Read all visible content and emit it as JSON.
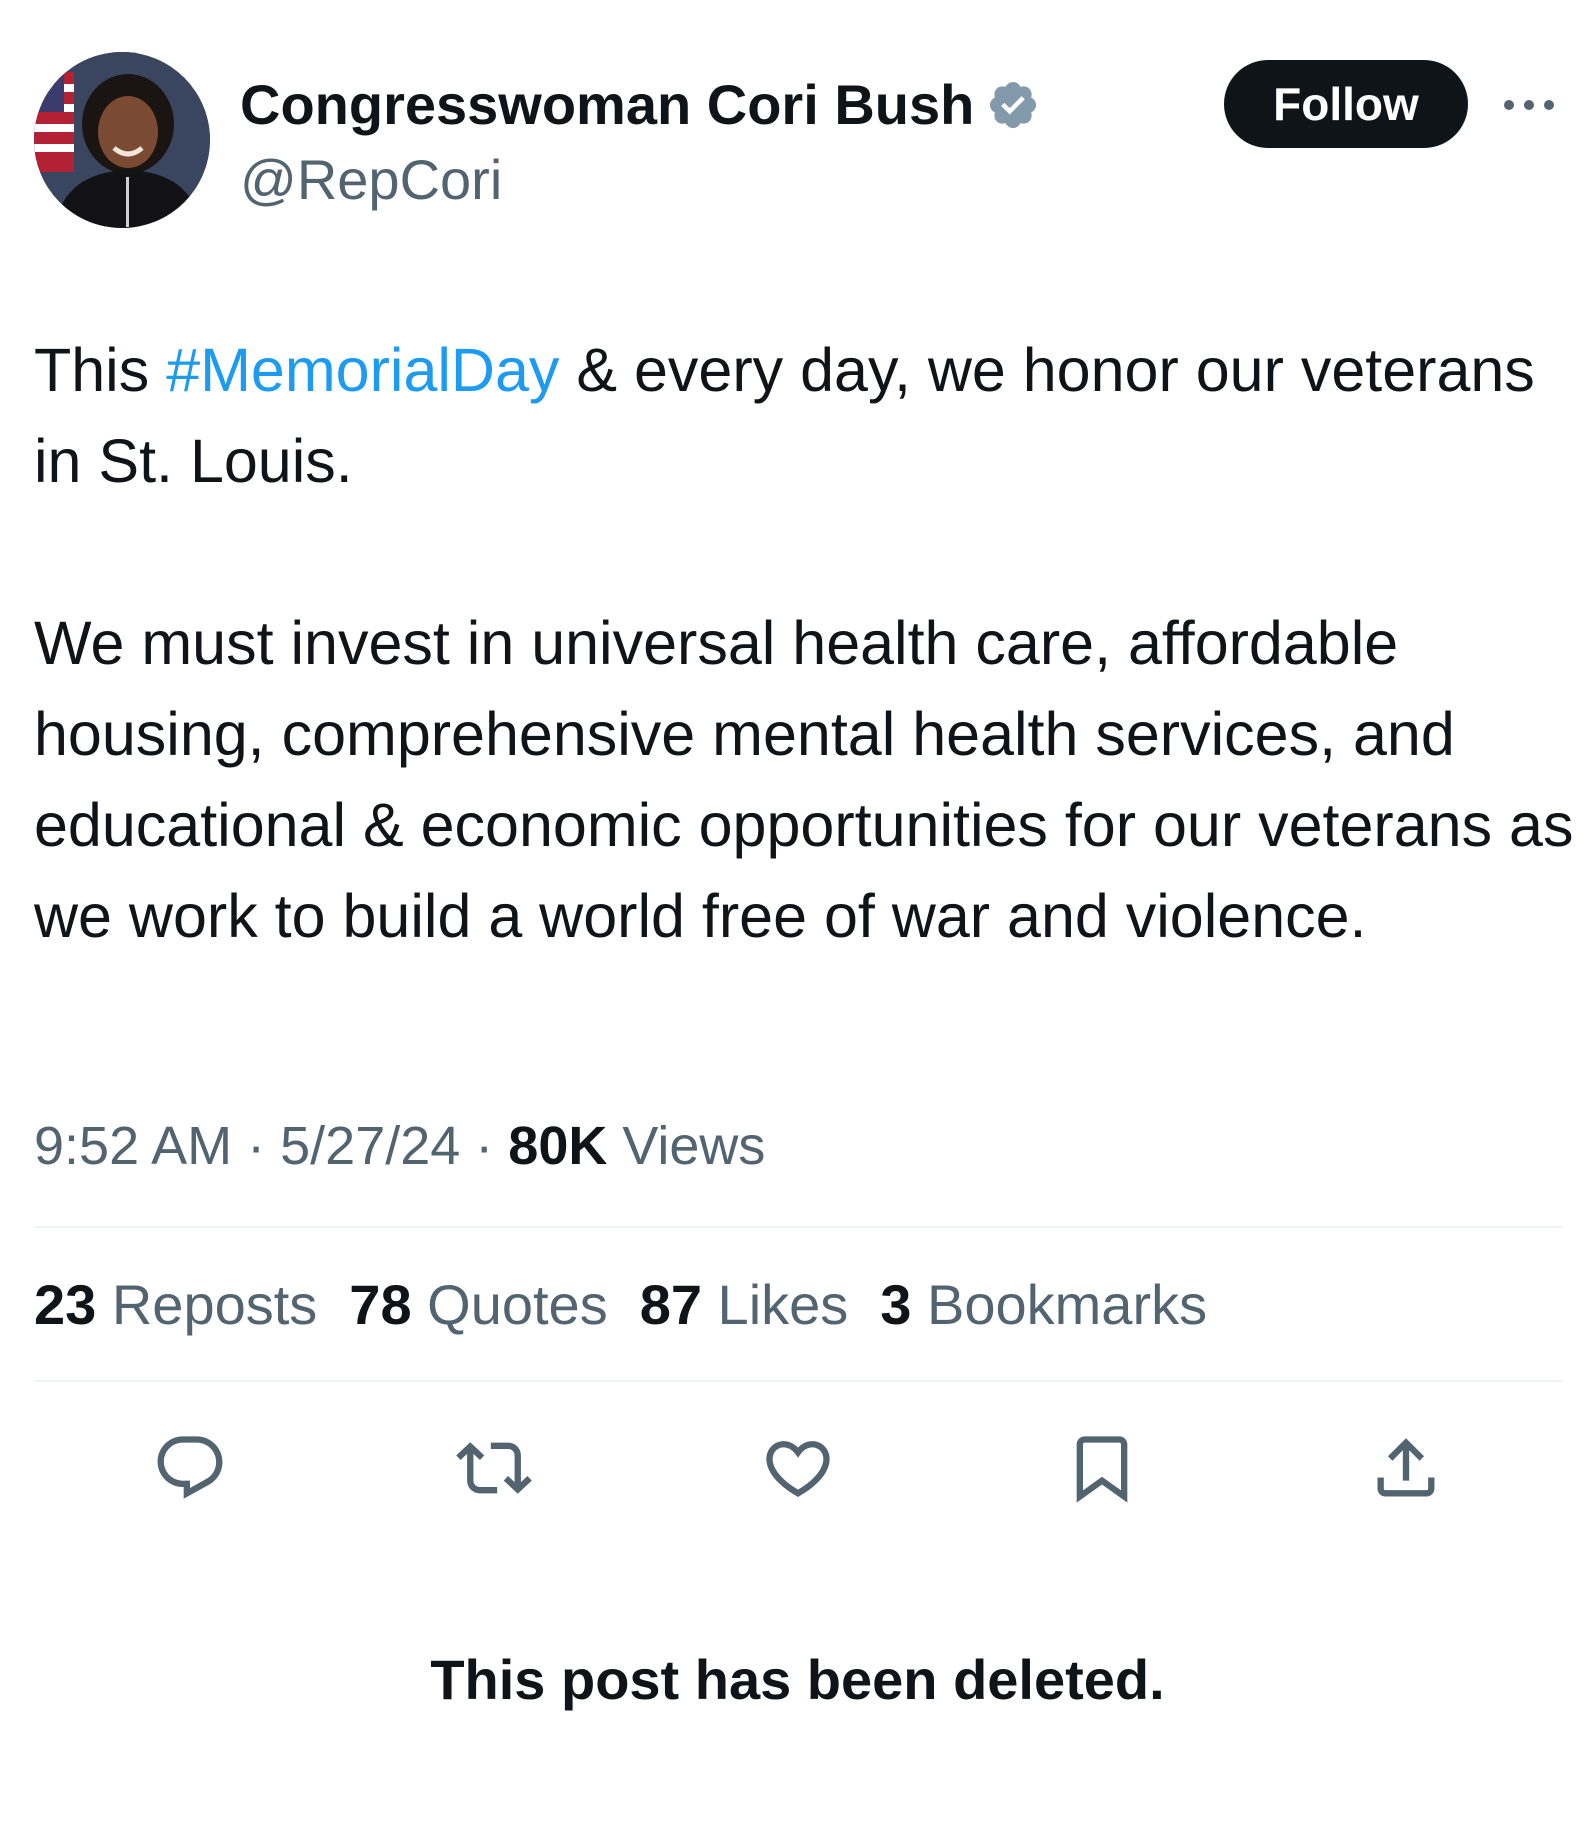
{
  "author": {
    "display_name": "Congresswoman Cori Bush",
    "handle": "@RepCori",
    "verified_icon": "verified-badge-icon",
    "avatar": "profile-photo"
  },
  "header": {
    "follow_label": "Follow",
    "more_icon": "more-options-icon"
  },
  "tweet": {
    "p1_prefix": "This ",
    "p1_hashtag": "#MemorialDay",
    "p1_suffix": " & every day, we honor our veterans in St. Louis.",
    "p2": "We must invest in universal health care, affordable housing, comprehensive mental health services, and educational & economic opportunities for our veterans as we work to build a world free of war and violence."
  },
  "meta": {
    "time": "9:52 AM",
    "sep1": " · ",
    "date": "5/27/24",
    "sep2": " · ",
    "views_count": "80K",
    "views_label": " Views"
  },
  "stats": [
    {
      "num": "23",
      "label": " Reposts"
    },
    {
      "num": "78",
      "label": " Quotes"
    },
    {
      "num": "87",
      "label": " Likes"
    },
    {
      "num": "3",
      "label": " Bookmarks"
    }
  ],
  "actions": {
    "reply_icon": "reply-icon",
    "repost_icon": "repost-icon",
    "like_icon": "heart-icon",
    "bookmark_icon": "bookmark-icon",
    "share_icon": "share-icon"
  },
  "notice": "This post has been deleted.",
  "colors": {
    "text": "#0f1419",
    "secondary": "#536471",
    "link": "#1d9bf0",
    "divider": "#eff3f4",
    "verified": "#829aab"
  }
}
